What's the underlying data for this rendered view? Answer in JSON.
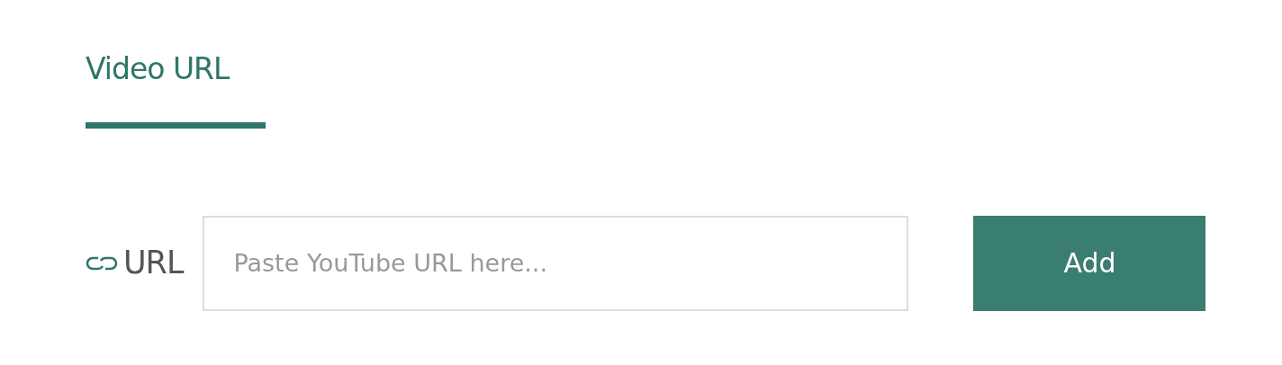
{
  "tabs": [
    {
      "label": "Video URL",
      "selected": true
    }
  ],
  "url_field": {
    "label": "URL",
    "placeholder": "Paste YouTube URL here..."
  },
  "buttons": [
    "Add"
  ]
}
